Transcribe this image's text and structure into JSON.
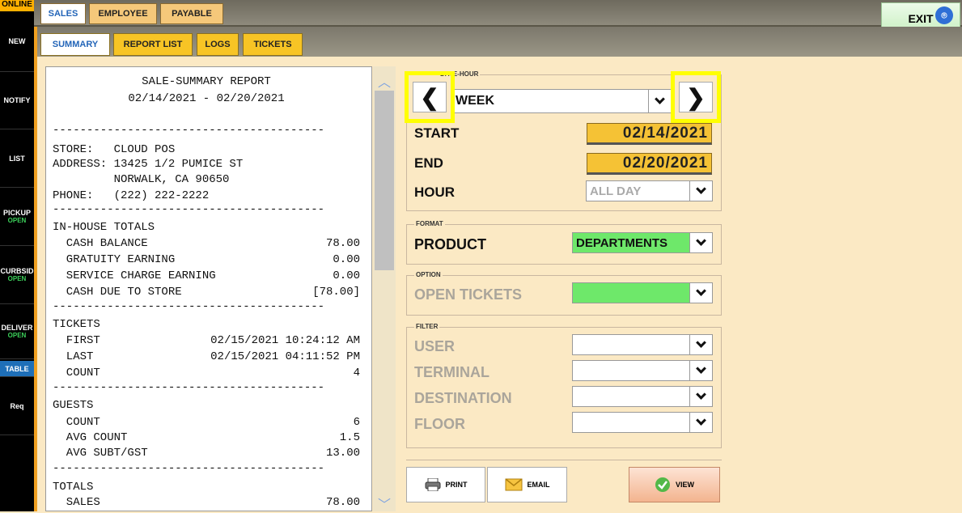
{
  "sidebar": {
    "online": "ONLINE",
    "items": [
      {
        "label": "NEW",
        "status": ""
      },
      {
        "label": "NOTIFY",
        "status": ""
      },
      {
        "label": "LIST",
        "status": ""
      },
      {
        "label": "PICKUP",
        "status": "OPEN"
      },
      {
        "label": "CURBSID",
        "status": "OPEN"
      },
      {
        "label": "DELIVER",
        "status": "OPEN"
      },
      {
        "label": "TABLE",
        "status": ""
      },
      {
        "label": "Req",
        "status": ""
      }
    ]
  },
  "tabs": [
    "SALES",
    "EMPLOYEE",
    "PAYABLE"
  ],
  "subtabs": [
    "SUMMARY",
    "REPORT LIST",
    "LOGS",
    "TICKETS"
  ],
  "exit": "EXIT",
  "report": {
    "title": "SALE-SUMMARY REPORT",
    "range": "02/14/2021 - 02/20/2021",
    "divider": "----------------------------------------",
    "store": "STORE:   CLOUD POS",
    "address1": "ADDRESS: 13425 1/2 PUMICE ST",
    "address2": "         NORWALK, CA 90650",
    "phone": "PHONE:   (222) 222-2222",
    "inhouse": "IN-HOUSE TOTALS",
    "cash_balance": [
      "  CASH BALANCE",
      "78.00"
    ],
    "gratuity": [
      "  GRATUITY EARNING",
      "0.00"
    ],
    "service": [
      "  SERVICE CHARGE EARNING",
      "0.00"
    ],
    "cash_due": [
      "  CASH DUE TO STORE",
      "[78.00]"
    ],
    "tickets": "TICKETS",
    "first": [
      "  FIRST",
      "02/15/2021 10:24:12 AM"
    ],
    "last": [
      "  LAST",
      "02/15/2021 04:11:52 PM"
    ],
    "count": [
      "  COUNT",
      "4"
    ],
    "guests": "GUESTS",
    "g_count": [
      "  COUNT",
      "6"
    ],
    "avg_count": [
      "  AVG COUNT",
      "1.5"
    ],
    "avg_subt": [
      "  AVG SUBT/GST",
      "13.00"
    ],
    "totals": "TOTALS",
    "sales": [
      "  SALES",
      "78.00"
    ]
  },
  "date_hour": {
    "legend": "DATE-HOUR",
    "period": "WEEK",
    "start_label": "START",
    "start": "02/14/2021",
    "end_label": "END",
    "end": "02/20/2021",
    "hour_label": "HOUR",
    "hour": "ALL DAY"
  },
  "format": {
    "legend": "FORMAT",
    "label": "PRODUCT",
    "value": "DEPARTMENTS"
  },
  "option": {
    "legend": "OPTION",
    "label": "OPEN TICKETS",
    "value": ""
  },
  "filter": {
    "legend": "FILTER",
    "rows": [
      "USER",
      "TERMINAL",
      "DESTINATION",
      "FLOOR"
    ]
  },
  "buttons": {
    "print": "PRINT",
    "email": "EMAIL",
    "view": "VIEW"
  }
}
